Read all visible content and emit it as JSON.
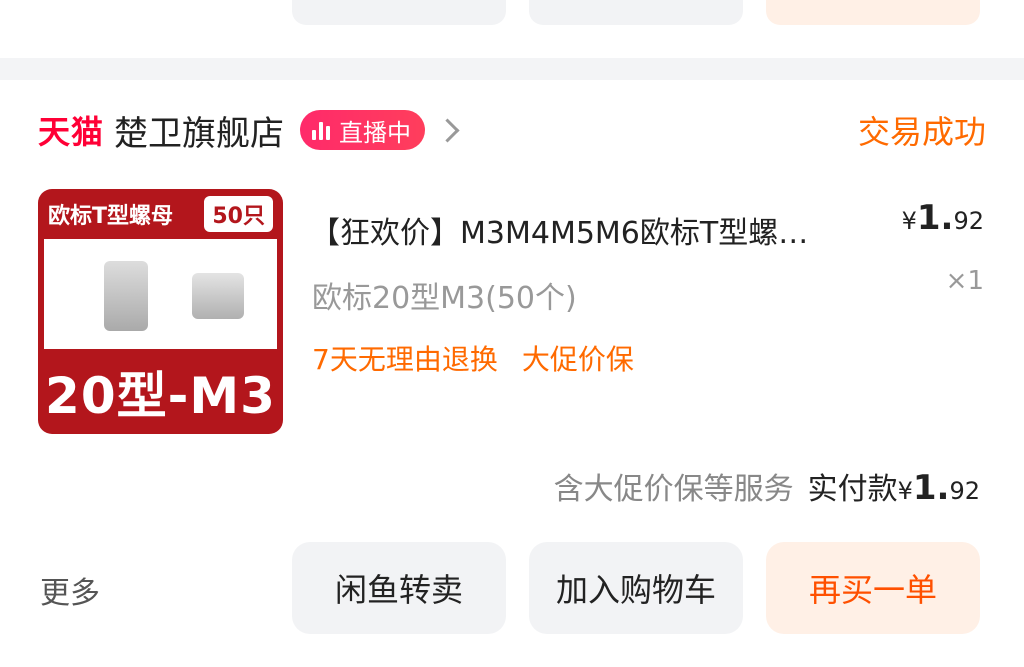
{
  "shop": {
    "platform": "天猫",
    "name": "楚卫旗舰店",
    "live_label": "直播中",
    "status": "交易成功"
  },
  "item": {
    "thumb_header": "欧标T型螺母",
    "thumb_qty": "50只",
    "thumb_footer": "20型-M3",
    "title": "【狂欢价】M3M4M5M6欧标T型螺…",
    "price_symbol": "¥",
    "price_int": "1.",
    "price_dec": "92",
    "spec": "欧标20型M3(50个)",
    "count": "×1",
    "tags": [
      "7天无理由退换",
      "大促价保"
    ]
  },
  "payment": {
    "service": "含大促价保等服务",
    "label": "实付款",
    "symbol": "¥",
    "int": "1.",
    "dec": "92"
  },
  "actions": {
    "more": "更多",
    "resell": "闲鱼转卖",
    "add_cart": "加入购物车",
    "rebuy": "再买一单"
  },
  "colors": {
    "accent": "#ff6a00",
    "tmall": "#ff0036",
    "live": "#ff2a6a",
    "thumb": "#b3161c"
  }
}
